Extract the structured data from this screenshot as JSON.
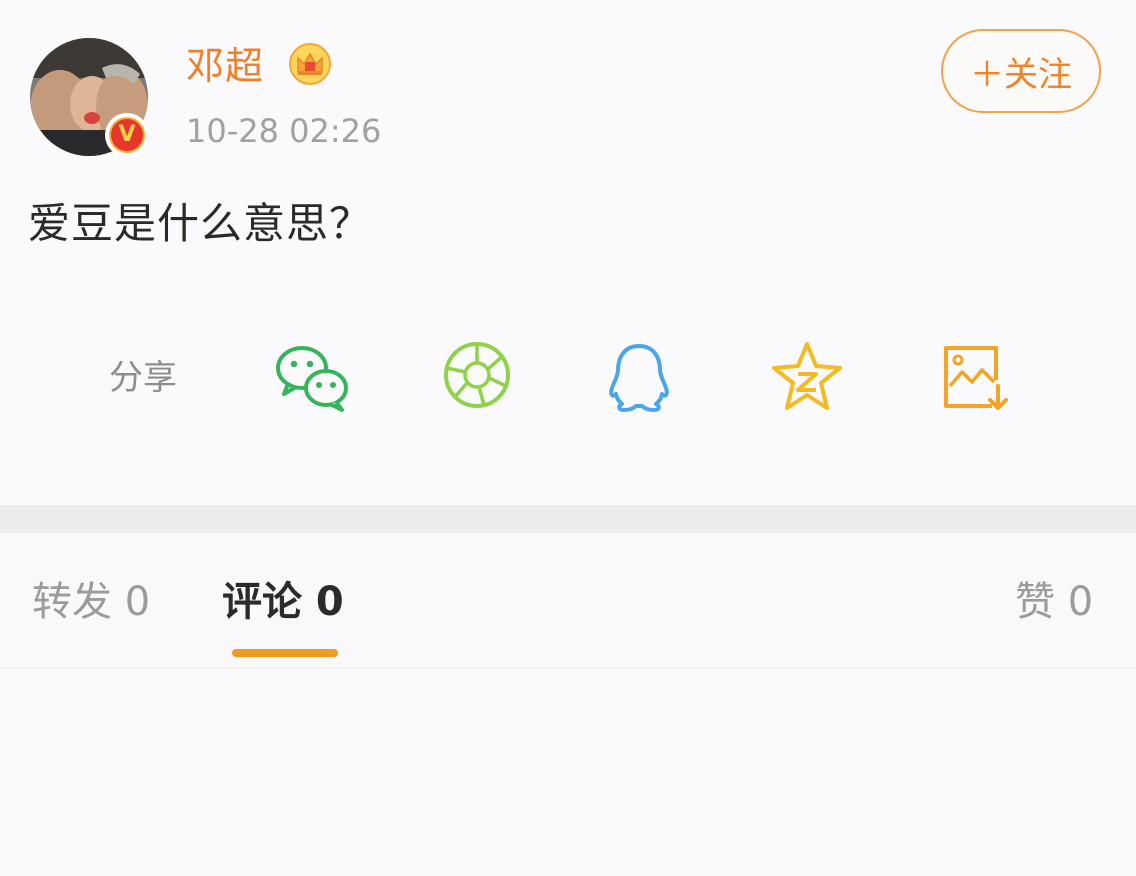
{
  "user": {
    "name": "邓超",
    "timestamp": "10-28 02:26",
    "verified_badge": "V"
  },
  "follow_button": {
    "label": "＋关注"
  },
  "post": {
    "text": "爱豆是什么意思？"
  },
  "share": {
    "label": "分享",
    "targets": [
      {
        "icon": "wechat-icon",
        "color": "#35b45a"
      },
      {
        "icon": "moments-icon",
        "color": "#8fd149"
      },
      {
        "icon": "qq-icon",
        "color": "#4aa6e8"
      },
      {
        "icon": "qzone-icon",
        "color": "#f5b922"
      },
      {
        "icon": "save-image-icon",
        "color": "#f5a425"
      }
    ]
  },
  "tabs": {
    "repost": "转发 0",
    "comment": "评论 0",
    "like": "赞 0",
    "active": "comment"
  },
  "colors": {
    "accent": "#f08427",
    "indicator": "#f39a22",
    "username": "#f07f29"
  }
}
